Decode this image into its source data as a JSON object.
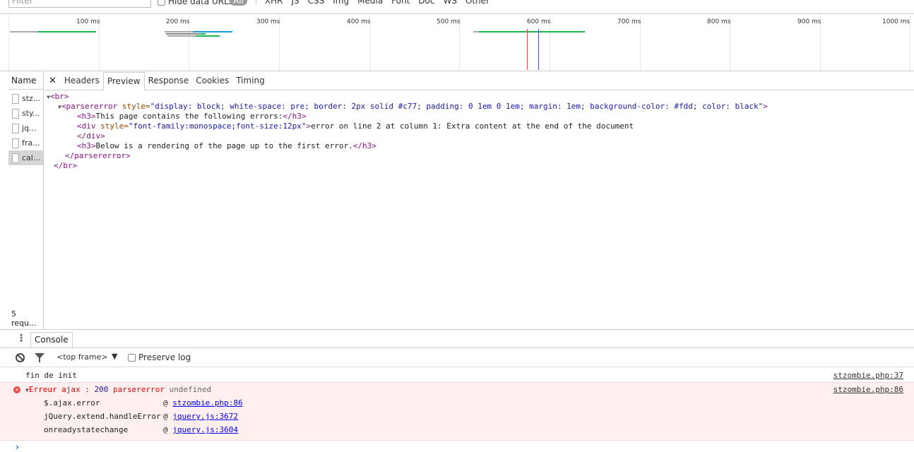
{
  "filter": {
    "placeholder": "Filter",
    "hide_data_urls": "Hide data URLs",
    "types": [
      "All",
      "XHR",
      "JS",
      "CSS",
      "Img",
      "Media",
      "Font",
      "Doc",
      "WS",
      "Other"
    ]
  },
  "overview": {
    "ticks": [
      "100 ms",
      "200 ms",
      "300 ms",
      "400 ms",
      "500 ms",
      "600 ms",
      "700 ms",
      "800 ms",
      "900 ms",
      "1000 ms"
    ]
  },
  "requests": {
    "header": "Name",
    "items": [
      "stz...",
      "sty...",
      "jq...",
      "fra...",
      "cal..."
    ],
    "count": "5 requ..."
  },
  "tabs": {
    "close": "✕",
    "items": [
      "Headers",
      "Preview",
      "Response",
      "Cookies",
      "Timing"
    ],
    "active": "Preview"
  },
  "preview": {
    "l1_tag": "<br>",
    "l2_tag_open": "<parsererror",
    "l2_attr": " style=",
    "l2_val": "\"display: block; white-space: pre; border: 2px solid #c77; padding: 0 1em 0 1em; margin: 1em; background-color: #fdd; color: black\"",
    "l2_close": ">",
    "l3_open": "<h3>",
    "l3_text": "This page contains the following errors:",
    "l3_close": "</h3>",
    "l4_tag": "<div",
    "l4_attr": " style=",
    "l4_val": "\"font-family:monospace;font-size:12px\"",
    "l4_close": ">",
    "l4_text": "error on line 2 at column 1: Extra content at the end of the document",
    "l5_tag": "</div>",
    "l6_open": "<h3>",
    "l6_text": "Below is a rendering of the page up to the first error.",
    "l6_close": "</h3>",
    "l7_tag": "</parsererror>",
    "l8_tag": "</br>"
  },
  "console": {
    "tab": "Console",
    "frame": "<top frame>",
    "frame_arrow": "▼",
    "preserve_log": "Preserve log",
    "log1": {
      "text": "fin de init",
      "source": "stzombie.php:37"
    },
    "error": {
      "prefix": "Erreur ajax : ",
      "status": "200",
      "type": " parsererror ",
      "detail": "undefined",
      "source": "stzombie.php:86",
      "stack": [
        {
          "fn": "$.ajax.error",
          "link": "stzombie.php:86"
        },
        {
          "fn": "jQuery.extend.handleError",
          "link": "jquery.js:3672"
        },
        {
          "fn": "onreadystatechange",
          "link": "jquery.js:3604"
        }
      ]
    },
    "prompt": "›"
  }
}
